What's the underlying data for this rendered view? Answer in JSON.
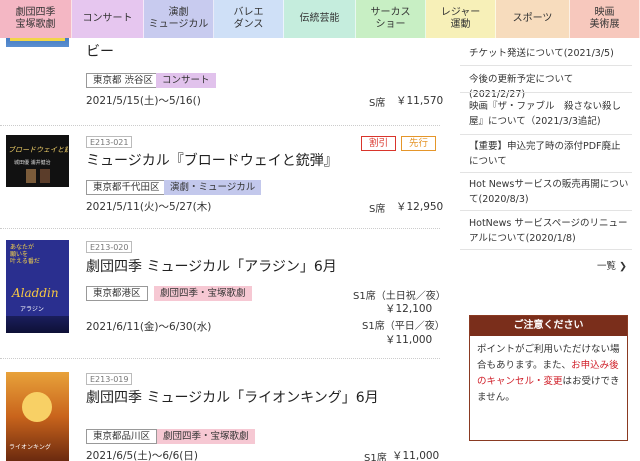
{
  "nav": [
    {
      "label": "劇団四季\n宝塚歌劇",
      "color": "#f4b7c4"
    },
    {
      "label": "コンサート",
      "color": "#e6c6ef"
    },
    {
      "label": "演劇\nミュージカル",
      "color": "#c8cbef"
    },
    {
      "label": "バレエ\nダンス",
      "color": "#cfe0f7"
    },
    {
      "label": "伝統芸能",
      "color": "#c5eddd"
    },
    {
      "label": "サーカス\nショー",
      "color": "#c8efc4"
    },
    {
      "label": "レジャー\n運動",
      "color": "#f7f0b8"
    },
    {
      "label": "スポーツ",
      "color": "#f7dcbd"
    },
    {
      "label": "映画\n美術展",
      "color": "#f7c8bd"
    }
  ],
  "items": [
    {
      "code": "",
      "title": "ビー",
      "area": "東京都 渋谷区",
      "genre": "コンサート",
      "dates": "2021/5/15(土)～5/16()",
      "seats": [
        {
          "label": "S席",
          "price": "￥11,570"
        }
      ]
    },
    {
      "code": "E213-021",
      "title": "ミュージカル『ブロードウェイと銃弾』",
      "area": "東京都千代田区",
      "genre": "演劇・ミュージカル",
      "badges": {
        "discount": "割引",
        "presale": "先行"
      },
      "dates": "2021/5/11(火)～5/27(木)",
      "seats": [
        {
          "label": "S席",
          "price": "￥12,950"
        }
      ],
      "poster": {
        "line1": "ブロードウェイと銃弾",
        "line2": "城田優 浦井健治"
      }
    },
    {
      "code": "E213-020",
      "title": "劇団四季 ミュージカル「アラジン」6月",
      "area": "東京都港区",
      "genre": "劇団四季・宝塚歌劇",
      "dates": "2021/6/11(金)～6/30(水)",
      "seats": [
        {
          "label": "S1席（土日祝／夜）",
          "price": "￥12,100"
        },
        {
          "label": "S1席（平日／夜）",
          "price": "￥11,000"
        }
      ],
      "poster": {
        "line1": "あなたが\n願いを\n叶える番だ",
        "line2": "Aladdin",
        "line3": "アラジン"
      }
    },
    {
      "code": "E213-019",
      "title": "劇団四季 ミュージカル「ライオンキング」6月",
      "area": "東京都品川区",
      "genre": "劇団四季・宝塚歌劇",
      "dates": "2021/6/5(土)～6/6(日)",
      "seats": [
        {
          "label": "S1席",
          "price": "￥11,000"
        }
      ],
      "poster": {
        "line1": "ライオンキング"
      }
    }
  ],
  "news": [
    "チケット発送について(2021/3/5)",
    "今後の更新予定について(2021/2/27)",
    "映画『ザ・ファブル　殺さない殺し屋』について（2021/3/3追記)",
    "【重要】申込完了時の添付PDF廃止について",
    "Hot Newsサービスの販売再開について(2020/8/3)",
    "HotNews サービスページのリニューアルについて(2020/1/8)"
  ],
  "more_label": "一覧 ❯",
  "notice": {
    "title": "ご注意ください",
    "text1": "ポイントがご利用いただけない場合もあります。また、",
    "red": "お申込み後のキャンセル・変更",
    "text2": "はお受けできません。"
  }
}
